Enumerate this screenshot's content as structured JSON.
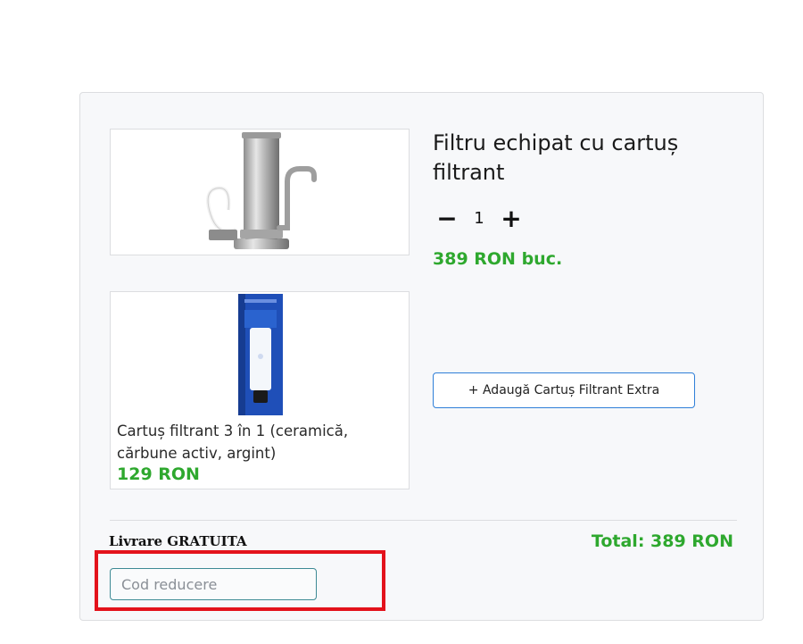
{
  "product": {
    "title": "Filtru echipat cu cartuș filtrant",
    "image_icon": "water-filter-faucet-icon",
    "quantity": "1",
    "minus_label": "−",
    "plus_label": "+",
    "unit_price": "389 RON buc."
  },
  "extra": {
    "image_icon": "filter-cartridge-icon",
    "description": "Cartuș filtrant 3 în 1 (ceramică, cărbune activ, argint)",
    "price": "129 RON",
    "add_button_label": "+ Adaugă Cartuș Filtrant Extra"
  },
  "summary": {
    "delivery": "Livrare GRATUITA",
    "total": "Total: 389 RON"
  },
  "discount": {
    "placeholder": "Cod reducere",
    "value": ""
  },
  "colors": {
    "price_green": "#2ea82e",
    "accent_blue": "#2f7fd8",
    "highlight_red": "#e3121b"
  }
}
